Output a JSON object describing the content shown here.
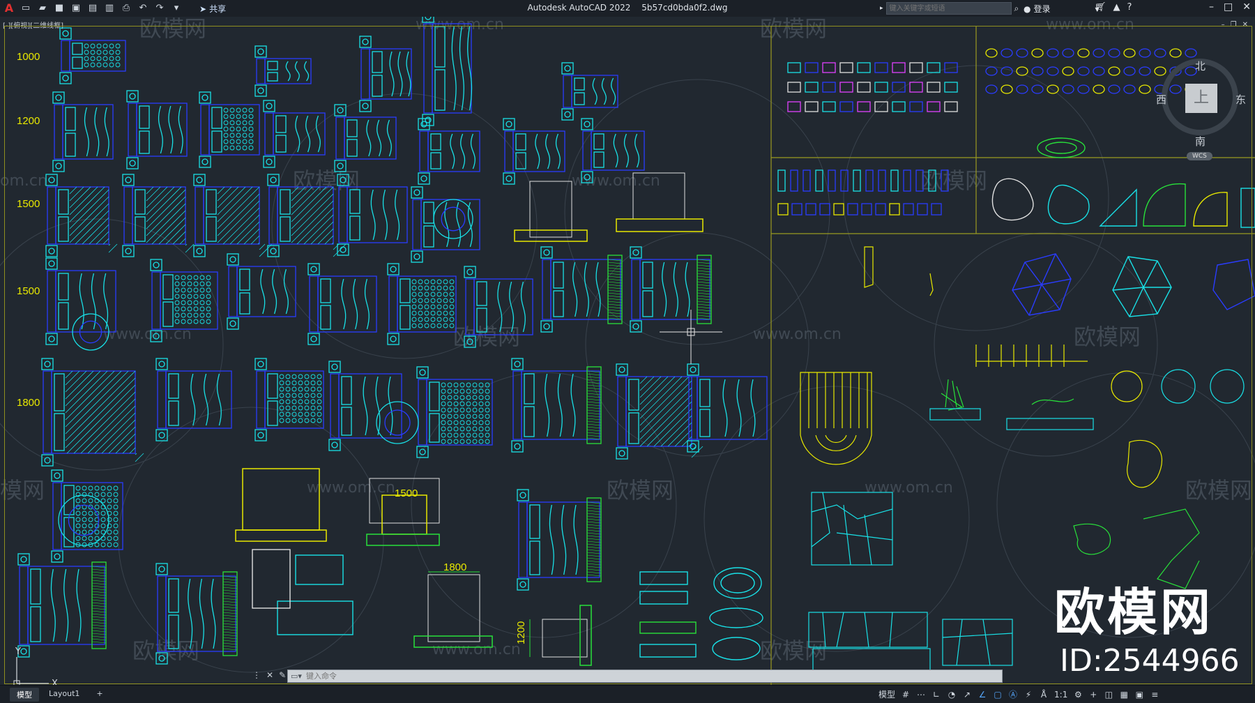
{
  "app": {
    "title": "Autodesk AutoCAD 2022",
    "filename": "5b57cd0bda0f2.dwg",
    "share_label": "共享",
    "search_placeholder": "键入关键字或短语",
    "signin_label": "登录"
  },
  "viewport": {
    "view_controls": "[-][俯视][二维线框]"
  },
  "dimensions": [
    "1000",
    "1200",
    "1500",
    "1500",
    "1800"
  ],
  "drawing_labels": {
    "bed_1500": "1500",
    "bed_1800": "1800",
    "bed_1200": "1200"
  },
  "watermarks": {
    "cn": "欧模网",
    "url": "www.om.cn",
    "url_partial": "om.cn",
    "cn_partial": "模网"
  },
  "viewcube": {
    "north": "北",
    "south": "南",
    "west": "西",
    "east": "东",
    "top": "上",
    "wcs": "WCS"
  },
  "ucs": {
    "x": "X",
    "y": "Y"
  },
  "brand": {
    "name": "欧模网",
    "id": "ID:2544966"
  },
  "command": {
    "placeholder": "键入命令"
  },
  "tabs": [
    "模型",
    "Layout1"
  ],
  "statusbar": {
    "model_label": "模型",
    "scale": "1:1"
  },
  "colors": {
    "background": "#212830",
    "blue_lines": "#2a3cff",
    "cyan_lines": "#19e0e6",
    "yellow_lines": "#e8e800",
    "green_lines": "#28e03a"
  }
}
